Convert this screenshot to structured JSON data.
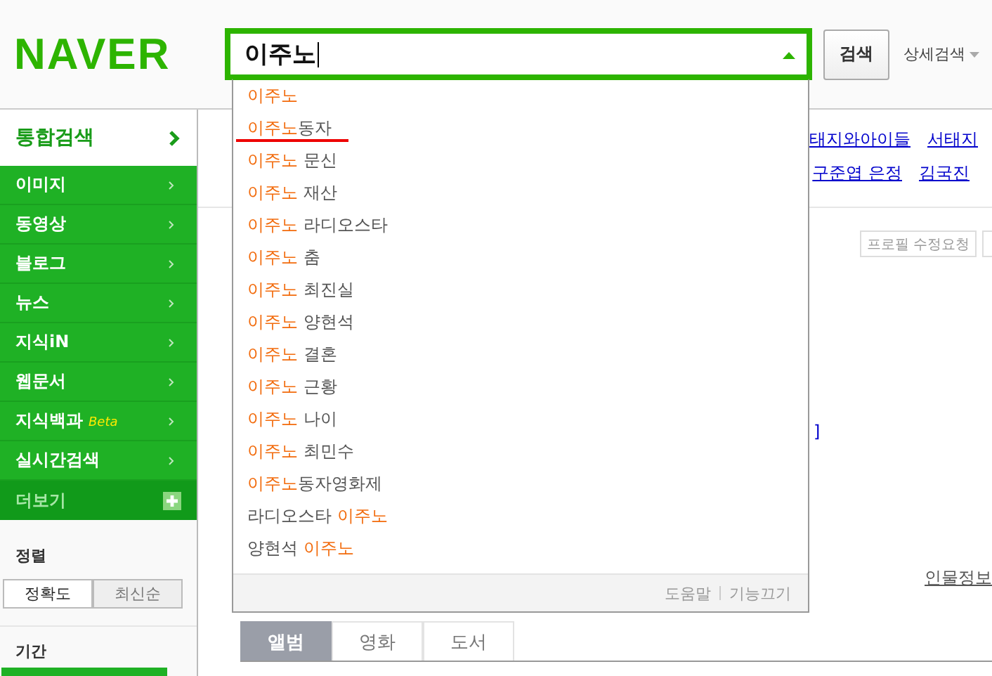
{
  "logo": "NAVER",
  "search": {
    "value": "이주노",
    "button": "검색",
    "advanced": "상세검색"
  },
  "suggestions": [
    {
      "parts": [
        {
          "text": "이주노",
          "highlight": true
        }
      ],
      "underlined": false
    },
    {
      "parts": [
        {
          "text": "이주노",
          "highlight": true
        },
        {
          "text": "동자",
          "highlight": false
        }
      ],
      "underlined": true
    },
    {
      "parts": [
        {
          "text": "이주노",
          "highlight": true
        },
        {
          "text": " 문신",
          "highlight": false
        }
      ],
      "underlined": false
    },
    {
      "parts": [
        {
          "text": "이주노",
          "highlight": true
        },
        {
          "text": " 재산",
          "highlight": false
        }
      ],
      "underlined": false
    },
    {
      "parts": [
        {
          "text": "이주노",
          "highlight": true
        },
        {
          "text": " 라디오스타",
          "highlight": false
        }
      ],
      "underlined": false
    },
    {
      "parts": [
        {
          "text": "이주노",
          "highlight": true
        },
        {
          "text": " 춤",
          "highlight": false
        }
      ],
      "underlined": false
    },
    {
      "parts": [
        {
          "text": "이주노",
          "highlight": true
        },
        {
          "text": " 최진실",
          "highlight": false
        }
      ],
      "underlined": false
    },
    {
      "parts": [
        {
          "text": "이주노",
          "highlight": true
        },
        {
          "text": " 양현석",
          "highlight": false
        }
      ],
      "underlined": false
    },
    {
      "parts": [
        {
          "text": "이주노",
          "highlight": true
        },
        {
          "text": " 결혼",
          "highlight": false
        }
      ],
      "underlined": false
    },
    {
      "parts": [
        {
          "text": "이주노",
          "highlight": true
        },
        {
          "text": " 근황",
          "highlight": false
        }
      ],
      "underlined": false
    },
    {
      "parts": [
        {
          "text": "이주노",
          "highlight": true
        },
        {
          "text": " 나이",
          "highlight": false
        }
      ],
      "underlined": false
    },
    {
      "parts": [
        {
          "text": "이주노",
          "highlight": true
        },
        {
          "text": " 최민수",
          "highlight": false
        }
      ],
      "underlined": false
    },
    {
      "parts": [
        {
          "text": "이주노",
          "highlight": true
        },
        {
          "text": "동자영화제",
          "highlight": false
        }
      ],
      "underlined": false
    },
    {
      "parts": [
        {
          "text": "라디오스타 ",
          "highlight": false
        },
        {
          "text": "이주노",
          "highlight": true
        }
      ],
      "underlined": false
    },
    {
      "parts": [
        {
          "text": "양현석 ",
          "highlight": false
        },
        {
          "text": "이주노",
          "highlight": true
        }
      ],
      "underlined": false
    }
  ],
  "dropdown_footer": [
    "도움말",
    "기능끄기"
  ],
  "sidebar": {
    "title": "통합검색",
    "items": [
      {
        "label": "이미지"
      },
      {
        "label": "동영상"
      },
      {
        "label": "블로그"
      },
      {
        "label": "뉴스"
      },
      {
        "label": "지식iN"
      },
      {
        "label": "웹문서"
      },
      {
        "label": "지식백과",
        "badge": "Beta"
      },
      {
        "label": "실시간검색"
      }
    ],
    "more": "더보기",
    "sort_label": "정렬",
    "sort_options": [
      {
        "label": "정확도",
        "selected": true
      },
      {
        "label": "최신순",
        "selected": false
      }
    ],
    "period_label": "기간"
  },
  "related_links": [
    [
      "태지와아이들",
      "서태지"
    ],
    [
      "구준엽 은정",
      "김국진"
    ]
  ],
  "profile_button": "프로필 수정요청",
  "bracket": "]",
  "person_info_link": "인물정보",
  "tabs": [
    {
      "label": "앨범",
      "selected": true
    },
    {
      "label": "영화",
      "selected": false
    },
    {
      "label": "도서",
      "selected": false
    }
  ]
}
